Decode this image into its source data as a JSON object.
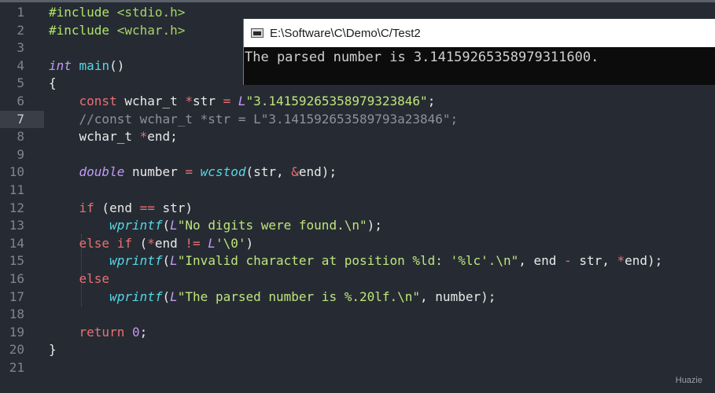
{
  "editor": {
    "line_numbers": [
      "1",
      "2",
      "3",
      "4",
      "5",
      "6",
      "7",
      "8",
      "9",
      "10",
      "11",
      "12",
      "13",
      "14",
      "15",
      "16",
      "17",
      "18",
      "19",
      "20",
      "21"
    ],
    "active_line": "7",
    "lines": [
      [
        "#include ",
        "<stdio.h>"
      ],
      [
        "#include ",
        "<wchar.h>"
      ],
      [],
      [
        "int",
        " ",
        "main",
        "()"
      ],
      [
        "{"
      ],
      [
        "    ",
        "const",
        " wchar_t ",
        "*",
        "str ",
        "=",
        " ",
        "L",
        "\"3.14159265358979323846\"",
        ";"
      ],
      [
        "    ",
        "//const wchar_t *str = L\"3.141592653589793a23846\";"
      ],
      [
        "    wchar_t ",
        "*",
        "end;"
      ],
      [],
      [
        "    ",
        "double",
        " number ",
        "=",
        " ",
        "wcstod",
        "(str, ",
        "&",
        "end);"
      ],
      [],
      [
        "    ",
        "if",
        " (end ",
        "==",
        " str)"
      ],
      [
        "        ",
        "wprintf",
        "(",
        "L",
        "\"No digits were found.\\n\"",
        ");"
      ],
      [
        "    ",
        "else if",
        " (",
        "*",
        "end ",
        "!=",
        " ",
        "L",
        "'\\0'",
        ")"
      ],
      [
        "        ",
        "wprintf",
        "(",
        "L",
        "\"Invalid character at position %ld: '%lc'.\\n\"",
        ", end ",
        "-",
        " str, ",
        "*",
        "end);"
      ],
      [
        "    ",
        "else"
      ],
      [
        "        ",
        "wprintf",
        "(",
        "L",
        "\"The parsed number is %.20lf.\\n\"",
        ", number);"
      ],
      [],
      [
        "    ",
        "return",
        " ",
        "0",
        ";"
      ],
      [
        "}"
      ],
      []
    ]
  },
  "console": {
    "title": "E:\\Software\\C\\Demo\\C/Test2",
    "output": "The parsed number is 3.14159265358979311600."
  },
  "watermark": "Huazie"
}
